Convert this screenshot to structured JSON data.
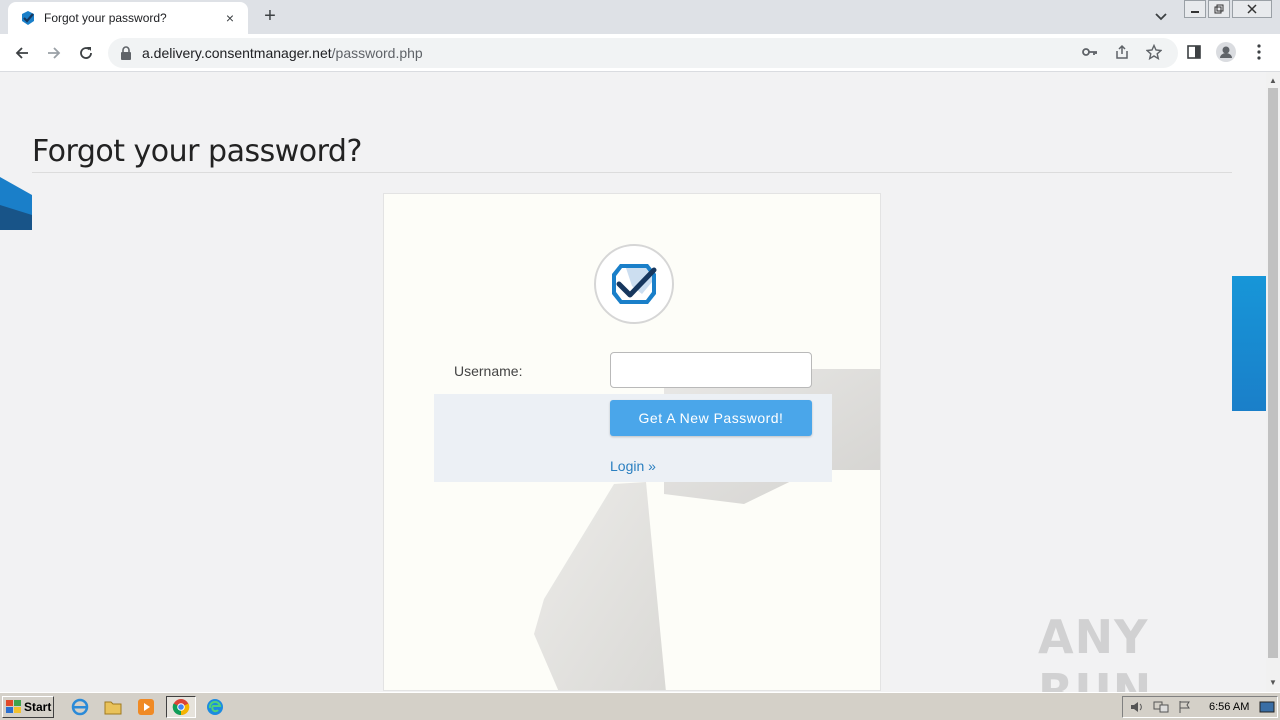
{
  "browser": {
    "tab_title": "Forgot your password?",
    "tab_close": "×",
    "new_tab": "+",
    "url_host": "a.delivery.consentmanager.net",
    "url_path": "/password.php"
  },
  "page": {
    "title": "Forgot your password?",
    "username_label": "Username:",
    "username_value": "",
    "submit_label": "Get A New Password!",
    "login_link": "Login »"
  },
  "watermark": "ANY RUN",
  "taskbar": {
    "start_label": "Start",
    "clock": "6:56 AM"
  },
  "colors": {
    "accent_button": "#4aa6ea",
    "link": "#2a7fc0",
    "brand_blue": "#1a7fc9",
    "brand_dark": "#17375e"
  }
}
